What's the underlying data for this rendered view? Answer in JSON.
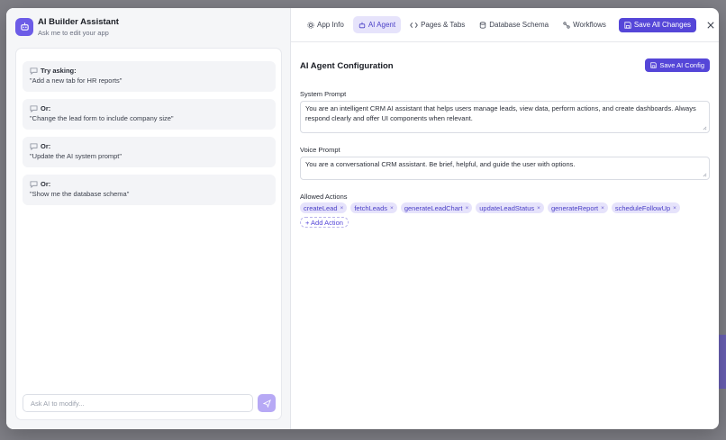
{
  "assistant": {
    "title": "AI Builder Assistant",
    "subtitle": "Ask me to edit your app",
    "suggestions": [
      {
        "label": "Try asking:",
        "text": "\"Add a new tab for HR reports\""
      },
      {
        "label": "Or:",
        "text": "\"Change the lead form to include company size\""
      },
      {
        "label": "Or:",
        "text": "\"Update the AI system prompt\""
      },
      {
        "label": "Or:",
        "text": "\"Show me the database schema\""
      }
    ],
    "input_placeholder": "Ask AI to modify..."
  },
  "tabs": [
    {
      "label": "App Info",
      "icon": "gear-icon",
      "active": false
    },
    {
      "label": "AI Agent",
      "icon": "bot-icon",
      "active": true
    },
    {
      "label": "Pages & Tabs",
      "icon": "code-icon",
      "active": false
    },
    {
      "label": "Database Schema",
      "icon": "database-icon",
      "active": false
    },
    {
      "label": "Workflows",
      "icon": "workflow-icon",
      "active": false
    }
  ],
  "save_all_label": "Save All Changes",
  "config": {
    "title": "AI Agent Configuration",
    "save_label": "Save AI Config",
    "system_prompt_label": "System Prompt",
    "system_prompt": "You are an intelligent CRM AI assistant that helps users manage leads, view data, perform actions, and create dashboards. Always respond clearly and offer UI components when relevant.",
    "voice_prompt_label": "Voice Prompt",
    "voice_prompt": "You are a conversational CRM assistant. Be brief, helpful, and guide the user with options.",
    "allowed_actions_label": "Allowed Actions",
    "allowed_actions": [
      "createLead",
      "fetchLeads",
      "generateLeadChart",
      "updateLeadStatus",
      "generateReport",
      "scheduleFollowUp"
    ],
    "add_action_label": "+ Add Action"
  },
  "colors": {
    "accent": "#5546d8",
    "accent_light": "#e6e3fb",
    "panel_bg": "#f5f6f8"
  }
}
